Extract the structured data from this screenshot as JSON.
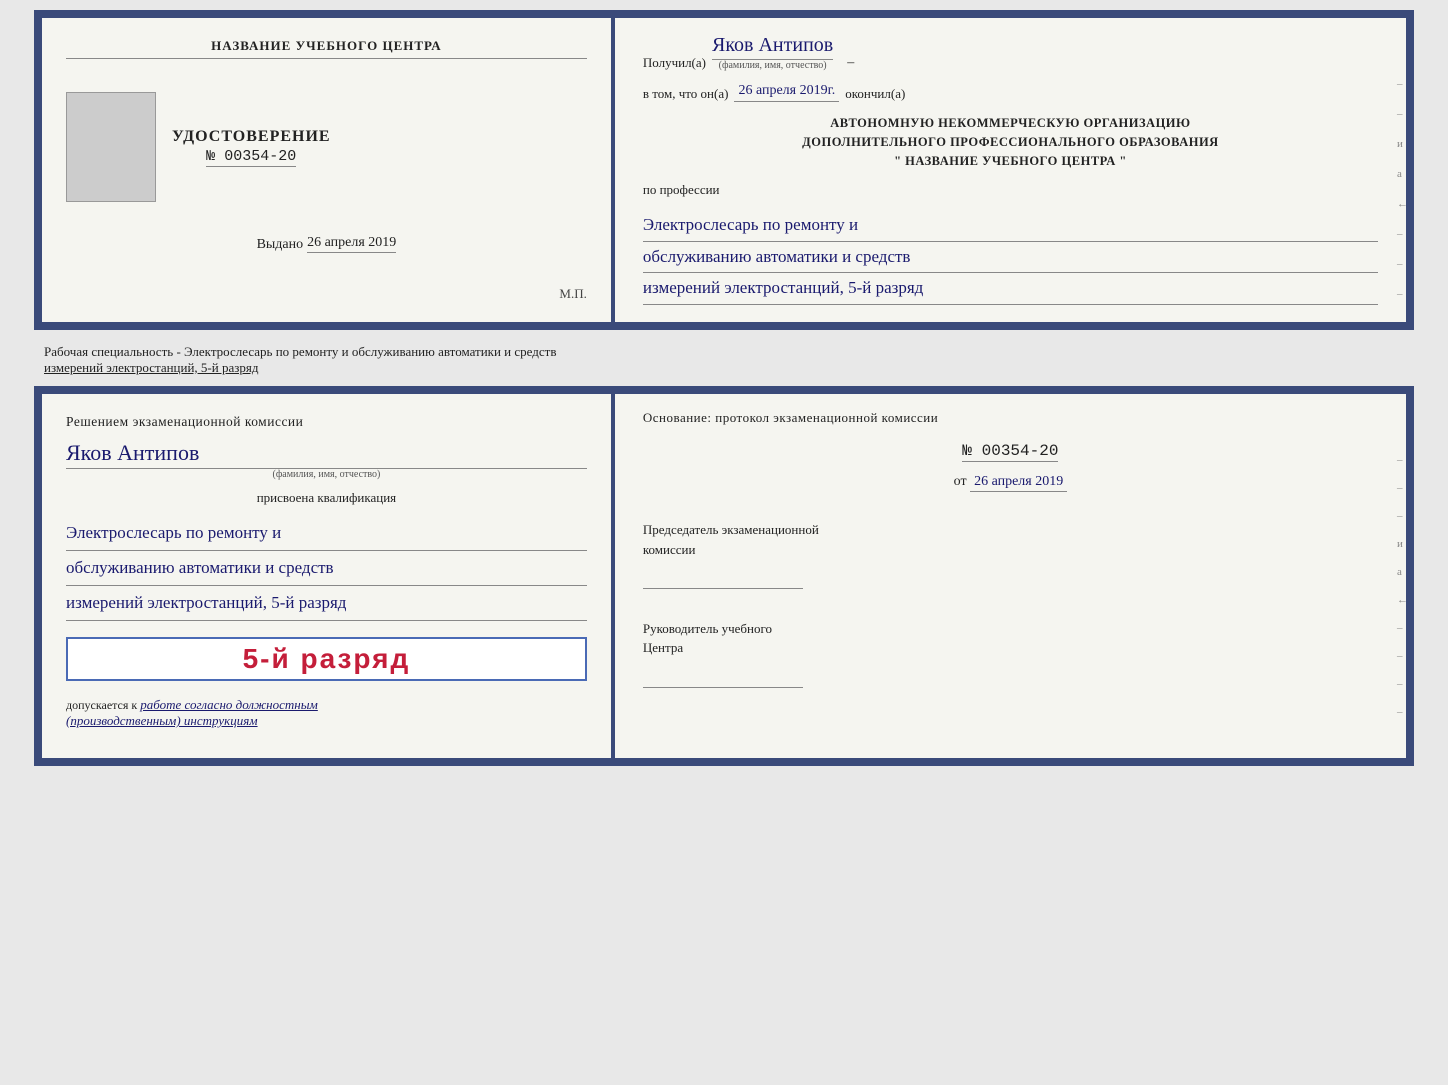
{
  "cert_top": {
    "left": {
      "school_name": "НАЗВАНИЕ УЧЕБНОГО ЦЕНТРА",
      "udostoverenie_title": "УДОСТОВЕРЕНИЕ",
      "cert_number": "№ 00354-20",
      "vydano_label": "Выдано",
      "vydano_date": "26 апреля 2019",
      "mp_label": "М.П."
    },
    "right": {
      "poluchil_label": "Получил(а)",
      "recipient_name": "Яков Антипов",
      "fio_subtitle": "(фамилия, имя, отчество)",
      "vtom_prefix": "в том, что он(а)",
      "vtom_date": "26 апреля 2019г.",
      "okonchil_label": "окончил(а)",
      "org_line1": "АВТОНОМНУЮ НЕКОММЕРЧЕСКУЮ ОРГАНИЗАЦИЮ",
      "org_line2": "ДОПОЛНИТЕЛЬНОГО ПРОФЕССИОНАЛЬНОГО ОБРАЗОВАНИЯ",
      "org_name": "\" НАЗВАНИЕ УЧЕБНОГО ЦЕНТРА \"",
      "po_professii": "по профессии",
      "profession_line1": "Электрослесарь по ремонту и",
      "profession_line2": "обслуживанию автоматики и средств",
      "profession_line3": "измерений электростанций, 5-й разряд"
    }
  },
  "middle": {
    "text": "Рабочая специальность - Электрослесарь по ремонту и обслуживанию автоматики и средств",
    "text2": "измерений электростанций, 5-й разряд"
  },
  "cert_bottom": {
    "left": {
      "resheniem": "Решением экзаменационной комиссии",
      "fio_name": "Яков Антипов",
      "fio_subtitle": "(фамилия, имя, отчество)",
      "prisvoena": "присвоена квалификация",
      "qual_line1": "Электрослесарь по ремонту и",
      "qual_line2": "обслуживанию автоматики и средств",
      "qual_line3": "измерений электростанций, 5-й разряд",
      "razryad_badge": "5-й разряд",
      "dopuskaetsya_prefix": "допускается к",
      "dopuskaetsya_italic": "работе согласно должностным",
      "dopuskaetsya_italic2": "(производственным) инструкциям"
    },
    "right": {
      "osnovanie_label": "Основание: протокол экзаменационной комиссии",
      "protocol_number": "№ 00354-20",
      "ot_label": "от",
      "ot_date": "26 апреля 2019",
      "predsedatel_label": "Председатель экзаменационной",
      "predsedatel_label2": "комиссии",
      "rukovoditel_label": "Руководитель учебного",
      "rukovoditel_label2": "Центра"
    }
  }
}
